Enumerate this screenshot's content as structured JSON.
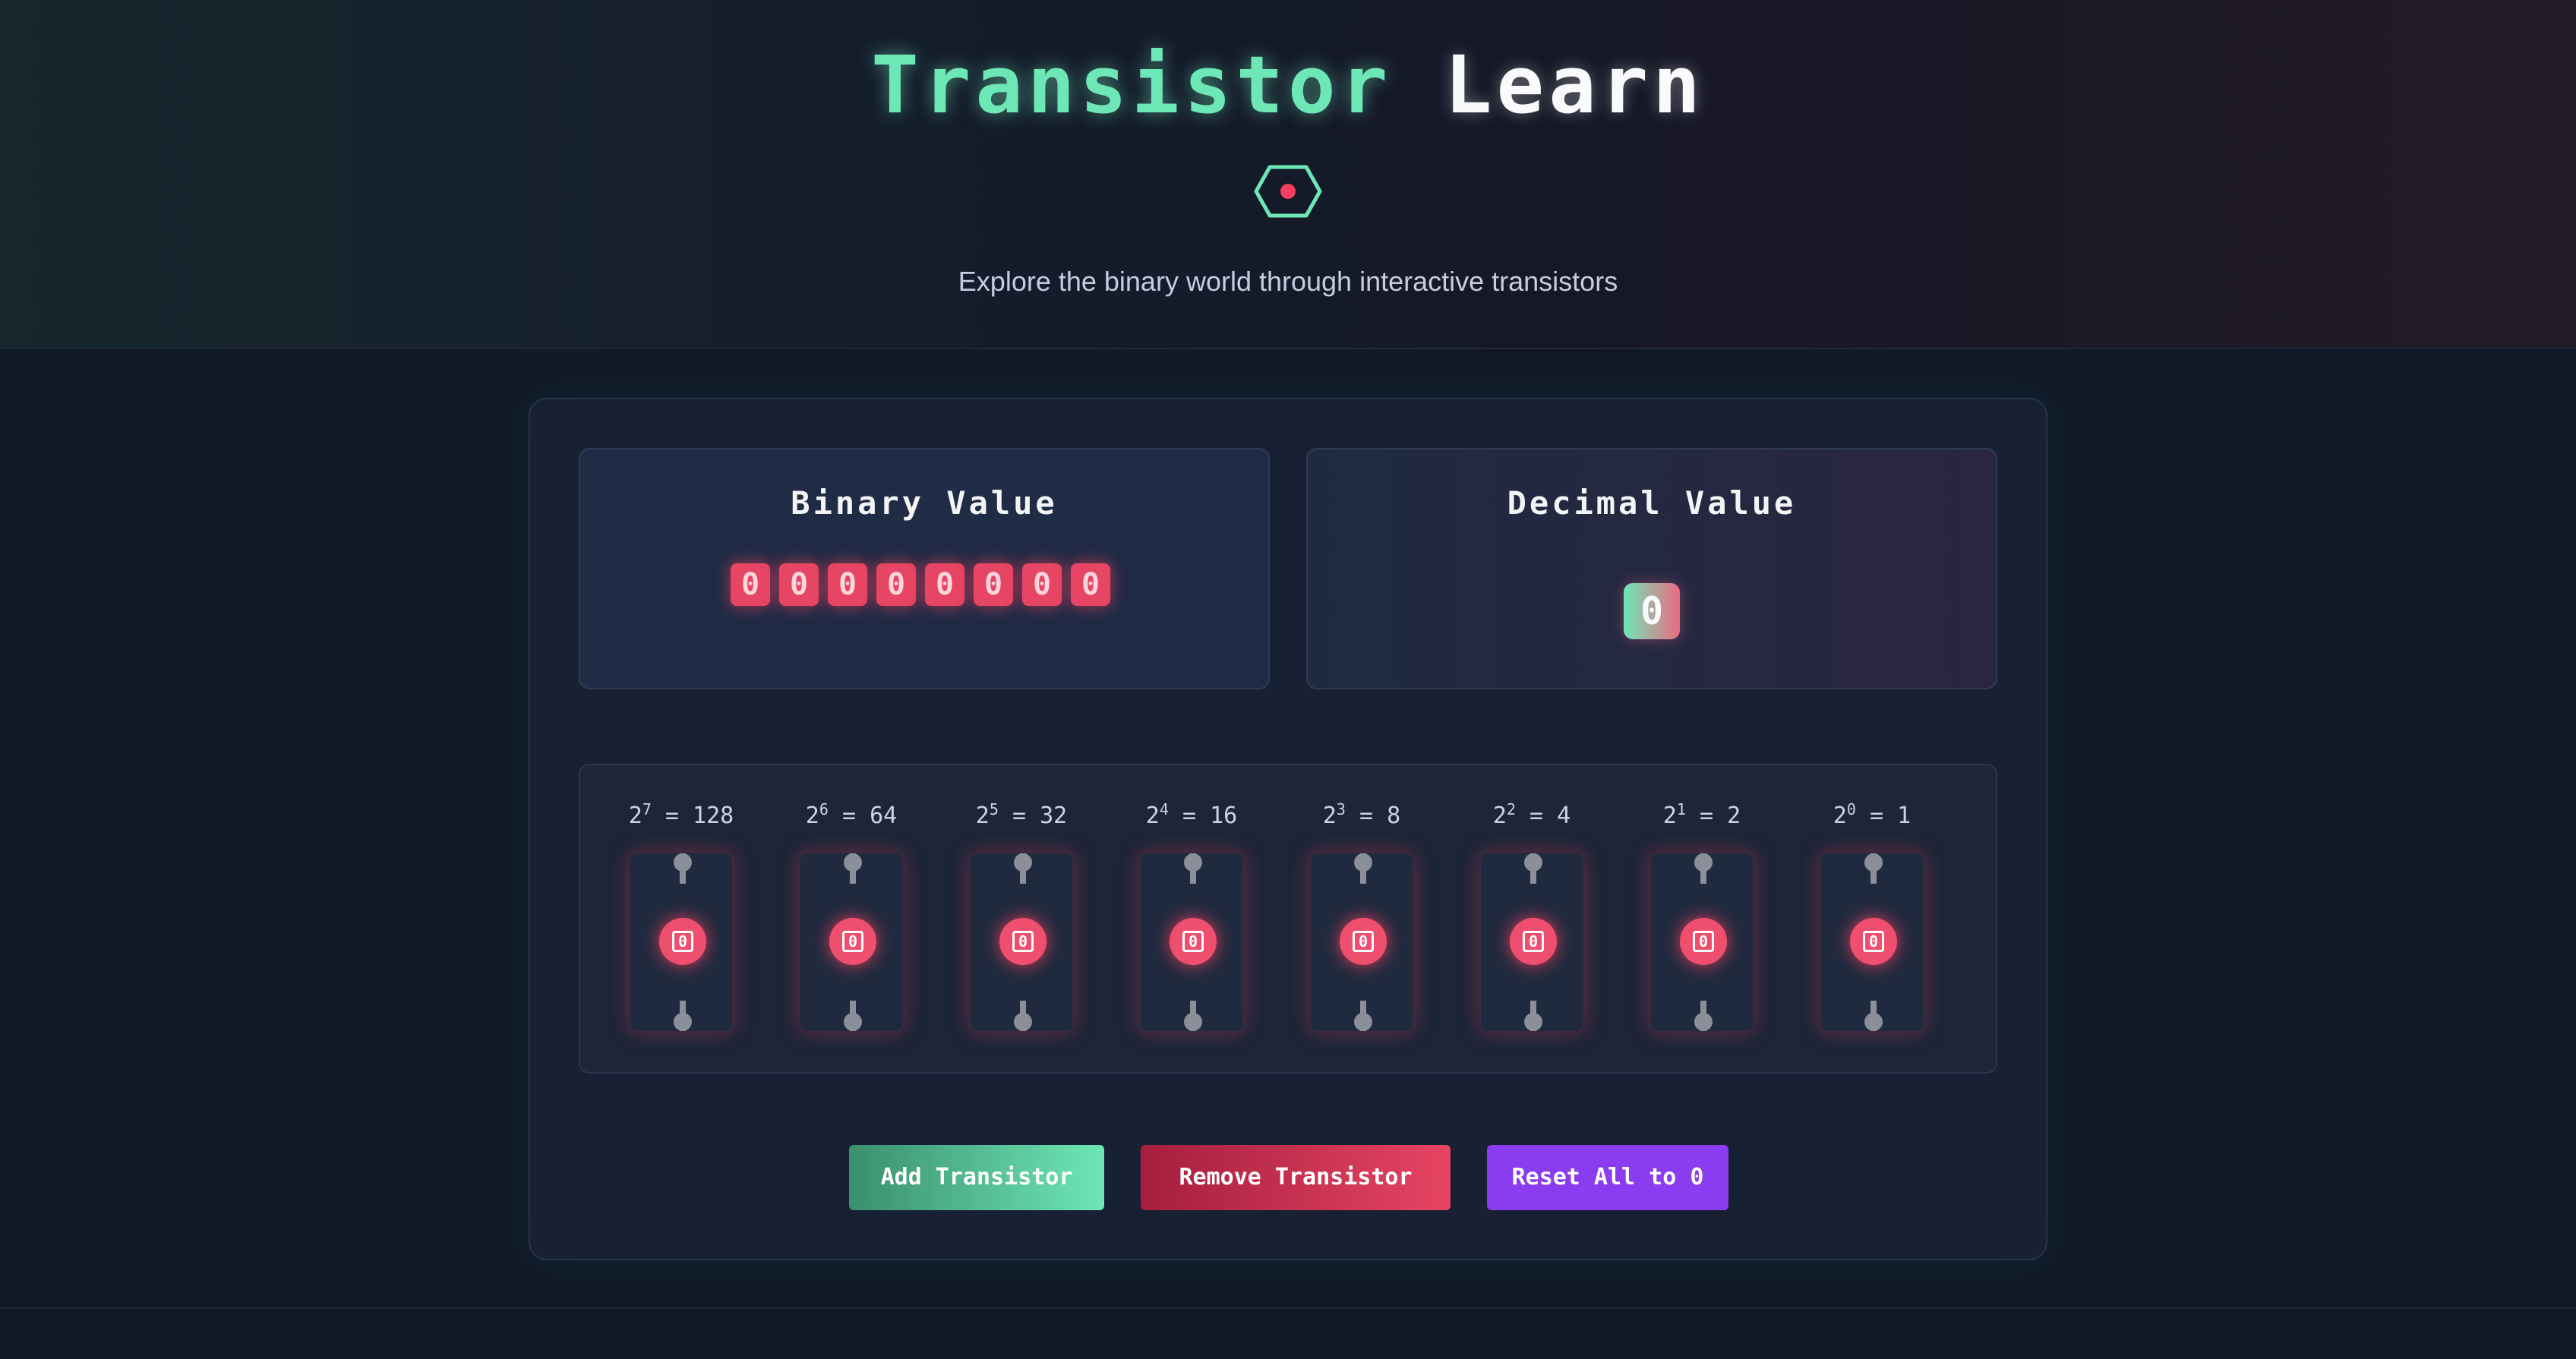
{
  "header": {
    "title_part1": "Transistor",
    "title_part2": "Learn",
    "logo_icon": "chip-eye-icon",
    "subtitle": "Explore the binary world through interactive transistors"
  },
  "binary_card": {
    "title": "Binary Value",
    "digits": [
      "0",
      "0",
      "0",
      "0",
      "0",
      "0",
      "0",
      "0"
    ]
  },
  "decimal_card": {
    "title": "Decimal Value",
    "value": "0"
  },
  "transistors": [
    {
      "base": "2",
      "exp": "7",
      "value": "= 128",
      "state": "0"
    },
    {
      "base": "2",
      "exp": "6",
      "value": "= 64",
      "state": "0"
    },
    {
      "base": "2",
      "exp": "5",
      "value": "= 32",
      "state": "0"
    },
    {
      "base": "2",
      "exp": "4",
      "value": "= 16",
      "state": "0"
    },
    {
      "base": "2",
      "exp": "3",
      "value": "= 8",
      "state": "0"
    },
    {
      "base": "2",
      "exp": "2",
      "value": "= 4",
      "state": "0"
    },
    {
      "base": "2",
      "exp": "1",
      "value": "= 2",
      "state": "0"
    },
    {
      "base": "2",
      "exp": "0",
      "value": "= 1",
      "state": "0"
    }
  ],
  "buttons": {
    "add": "Add Transistor",
    "remove": "Remove Transistor",
    "reset": "Reset All to 0"
  },
  "colors": {
    "accent_green": "#6ee7b7",
    "accent_red": "#e64563",
    "accent_purple": "#8a3cf0",
    "background": "#111827"
  }
}
